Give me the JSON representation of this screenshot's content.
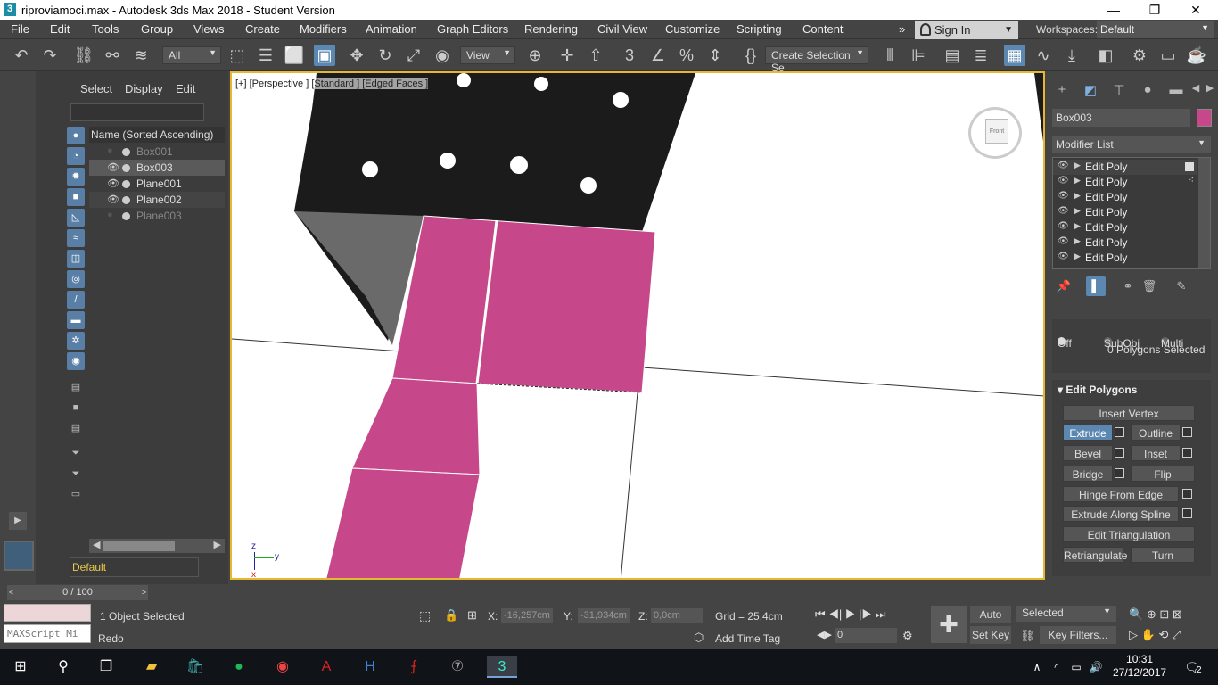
{
  "titlebar": {
    "title": "riproviamoci.max - Autodesk 3ds Max 2018 - Student Version",
    "app_icon": "3",
    "minimize": "—",
    "maximize": "❐",
    "close": "✕"
  },
  "menu": {
    "items": [
      "File",
      "Edit",
      "Tools",
      "Group",
      "Views",
      "Create",
      "Modifiers",
      "Animation",
      "Graph Editors",
      "Rendering",
      "Civil View",
      "Customize",
      "Scripting",
      "Content"
    ],
    "more": "»"
  },
  "account": {
    "sign_in": "Sign In",
    "workspaces_label": "Workspaces:",
    "workspace": "Default"
  },
  "toolbar": {
    "filter": "All",
    "ref_coord": "View",
    "selection_set": "Create Selection Se"
  },
  "scene_explorer": {
    "tabs": [
      "Select",
      "Display",
      "Edit"
    ],
    "column": "Name (Sorted Ascending)",
    "objects": [
      {
        "name": "Box001",
        "visible": false,
        "dim": true,
        "selected": false
      },
      {
        "name": "Box003",
        "visible": true,
        "dim": false,
        "selected": true
      },
      {
        "name": "Plane001",
        "visible": true,
        "dim": false,
        "selected": false
      },
      {
        "name": "Plane002",
        "visible": true,
        "dim": false,
        "selected": false
      },
      {
        "name": "Plane003",
        "visible": false,
        "dim": true,
        "selected": false
      }
    ],
    "layer": "Default",
    "tooltip": "Redo"
  },
  "viewport": {
    "label_plus": "[+]",
    "label_view": "[Perspective ]",
    "label_shading": "[Standard ]",
    "label_edged": "[Edged Faces ]",
    "viewcube_text": "Front",
    "axis_z": "z",
    "axis_y": "y",
    "axis_x": "x"
  },
  "command_panel": {
    "object_name": "Box003",
    "object_color": "#c7488a",
    "modifier_list": "Modifier List",
    "stack": [
      "Edit Poly",
      "Edit Poly",
      "Edit Poly",
      "Edit Poly",
      "Edit Poly",
      "Edit Poly",
      "Edit Poly"
    ],
    "preview": {
      "off": "Off",
      "subobj": "SubObj",
      "multi": "Multi"
    },
    "polys_selected": "0 Polygons Selected",
    "edit_polygons": {
      "title": "Edit Polygons",
      "insert_vertex": "Insert Vertex",
      "extrude": "Extrude",
      "outline": "Outline",
      "bevel": "Bevel",
      "inset": "Inset",
      "bridge": "Bridge",
      "flip": "Flip",
      "hinge": "Hinge From Edge",
      "extrude_spline": "Extrude Along Spline",
      "edit_tri": "Edit Triangulation",
      "retriangulate": "Retriangulate",
      "turn": "Turn"
    }
  },
  "timeline": {
    "frame": "0 / 100"
  },
  "status": {
    "selected": "1 Object Selected",
    "last_action": "Redo",
    "maxscript": "MAXScript Mi",
    "x_label": "X:",
    "x": "-16,257cm",
    "y_label": "Y:",
    "y": "-31,934cm",
    "z_label": "Z:",
    "z": "0,0cm",
    "grid": "Grid = 25,4cm",
    "add_time_tag": "Add Time Tag",
    "auto_key": "Auto Key",
    "set_key": "Set Key",
    "key_mode": "Selected",
    "key_filters": "Key Filters...",
    "frame_value": "0"
  },
  "taskbar": {
    "time": "10:31",
    "date": "27/12/2017",
    "notif": "2"
  }
}
